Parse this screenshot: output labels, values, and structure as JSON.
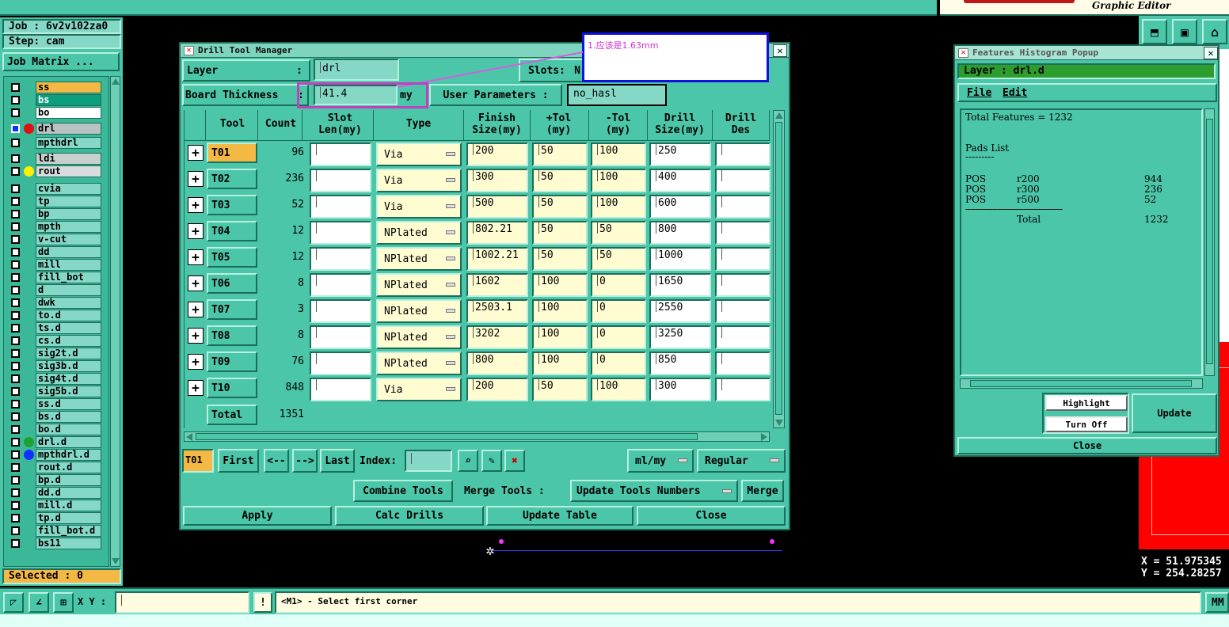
{
  "top": {
    "graphic_editor": "Graphic Editor"
  },
  "left_panel": {
    "job": "Job : 6v2v102za0",
    "step": "Step: cam",
    "job_matrix": "Job Matrix ...",
    "selected": "Selected : 0",
    "layers": [
      {
        "name": "ss",
        "color": "#f4b844"
      },
      {
        "name": "bs",
        "color": "#0e9e7e"
      },
      {
        "name": "bo",
        "color": "#ffffff"
      },
      {
        "name": "drl",
        "color": "#b8c2c0",
        "dot": "#e01010"
      },
      {
        "name": "mpthdrl",
        "color": "#86d8c6"
      },
      {
        "name": "ldi",
        "color": "#c8d0ce"
      },
      {
        "name": "rout",
        "color": "#d8dcdc",
        "dot": "#ffee00"
      },
      {
        "name": "cvia"
      },
      {
        "name": "tp"
      },
      {
        "name": "bp"
      },
      {
        "name": "mpth"
      },
      {
        "name": "v-cut"
      },
      {
        "name": "dd"
      },
      {
        "name": "mill"
      },
      {
        "name": "fill_bot"
      },
      {
        "name": "d"
      },
      {
        "name": "dwk"
      },
      {
        "name": "to.d"
      },
      {
        "name": "ts.d"
      },
      {
        "name": "cs.d"
      },
      {
        "name": "sig2t.d"
      },
      {
        "name": "sig3b.d"
      },
      {
        "name": "sig4t.d"
      },
      {
        "name": "sig5b.d"
      },
      {
        "name": "ss.d"
      },
      {
        "name": "bs.d"
      },
      {
        "name": "bo.d"
      },
      {
        "name": "drl.d",
        "dot": "#20a030"
      },
      {
        "name": "mpthdrl.d",
        "dot": "#1030ff"
      },
      {
        "name": "rout.d"
      },
      {
        "name": "bp.d"
      },
      {
        "name": "dd.d"
      },
      {
        "name": "mill.d"
      },
      {
        "name": "tp.d"
      },
      {
        "name": "fill_bot.d"
      },
      {
        "name": "bs11"
      }
    ]
  },
  "drill_manager": {
    "title": "Drill Tool Manager",
    "layer_label": "Layer",
    "layer_sep": ":",
    "layer_value": "drl",
    "slots_label": "Slots:",
    "slots_value": "N",
    "thickness_label": "Board Thickness",
    "thickness_sep": ":",
    "thickness_value": "41.4",
    "thickness_unit": "my",
    "user_params_label": "User Parameters :",
    "user_params_value": "no_hasl",
    "annotation": "1.应该是1.63mm",
    "headers": [
      "Tool",
      "Count",
      "Slot\nLen(my)",
      "Type",
      "Finish\nSize(my)",
      "+Tol\n(my)",
      "-Tol\n(my)",
      "Drill\nSize(my)",
      "Drill\nDes"
    ],
    "rows": [
      {
        "tool": "T01",
        "count": "96",
        "type": "Via",
        "finish": "200",
        "ptol": "50",
        "mtol": "100",
        "drill": "250"
      },
      {
        "tool": "T02",
        "count": "236",
        "type": "Via",
        "finish": "300",
        "ptol": "50",
        "mtol": "100",
        "drill": "400"
      },
      {
        "tool": "T03",
        "count": "52",
        "type": "Via",
        "finish": "500",
        "ptol": "50",
        "mtol": "100",
        "drill": "600"
      },
      {
        "tool": "T04",
        "count": "12",
        "type": "NPlated",
        "finish": "802.21",
        "ptol": "50",
        "mtol": "50",
        "drill": "800"
      },
      {
        "tool": "T05",
        "count": "12",
        "type": "NPlated",
        "finish": "1002.21",
        "ptol": "50",
        "mtol": "50",
        "drill": "1000"
      },
      {
        "tool": "T06",
        "count": "8",
        "type": "NPlated",
        "finish": "1602",
        "ptol": "100",
        "mtol": "0",
        "drill": "1650"
      },
      {
        "tool": "T07",
        "count": "3",
        "type": "NPlated",
        "finish": "2503.1",
        "ptol": "100",
        "mtol": "0",
        "drill": "2550"
      },
      {
        "tool": "T08",
        "count": "8",
        "type": "NPlated",
        "finish": "3202",
        "ptol": "100",
        "mtol": "0",
        "drill": "3250"
      },
      {
        "tool": "T09",
        "count": "76",
        "type": "NPlated",
        "finish": "800",
        "ptol": "100",
        "mtol": "0",
        "drill": "850"
      },
      {
        "tool": "T10",
        "count": "848",
        "type": "Via",
        "finish": "200",
        "ptol": "50",
        "mtol": "100",
        "drill": "300"
      }
    ],
    "total_label": "Total",
    "total_value": "1351",
    "current_tool": "T01",
    "nav": {
      "first": "First",
      "prev": "<--",
      "next": "-->",
      "last": "Last",
      "index": "Index:"
    },
    "units": "ml/my",
    "mode": "Regular",
    "combine": "Combine Tools",
    "merge_tools": "Merge Tools :",
    "update_numbers": "Update Tools Numbers",
    "merge": "Merge",
    "apply": "Apply",
    "calc": "Calc Drills",
    "update_table": "Update Table",
    "close": "Close"
  },
  "histogram": {
    "title": "Features Histogram Popup",
    "layer": "Layer :  drl.d",
    "file": "File",
    "edit": "Edit",
    "total_features": "Total Features = 1232",
    "pads_list": "Pads List",
    "pads_underline": "---------",
    "pads": [
      {
        "pos": "POS",
        "sym": "r200",
        "count": "944"
      },
      {
        "pos": "POS",
        "sym": "r300",
        "count": "236"
      },
      {
        "pos": "POS",
        "sym": "r500",
        "count": "52"
      }
    ],
    "divider": "----------------------------------------",
    "total_label": "Total",
    "total_value": "1232",
    "highlight": "Highlight",
    "turn_off": "Turn Off",
    "update": "Update",
    "close": "Close"
  },
  "bottom": {
    "xy_label": "X Y :",
    "status": "<M1> - Select first corner",
    "mm": "MM",
    "x_readout": "X = 51.975345",
    "y_readout": "Y = 254.28257"
  },
  "colors": {
    "panel": "#4cc6a8",
    "accent_orange": "#f4b844",
    "annotation_border": "#1010e0",
    "annotation_text": "#d030d0",
    "highlight_box": "#c040c0",
    "red_area": "#ff0000"
  }
}
